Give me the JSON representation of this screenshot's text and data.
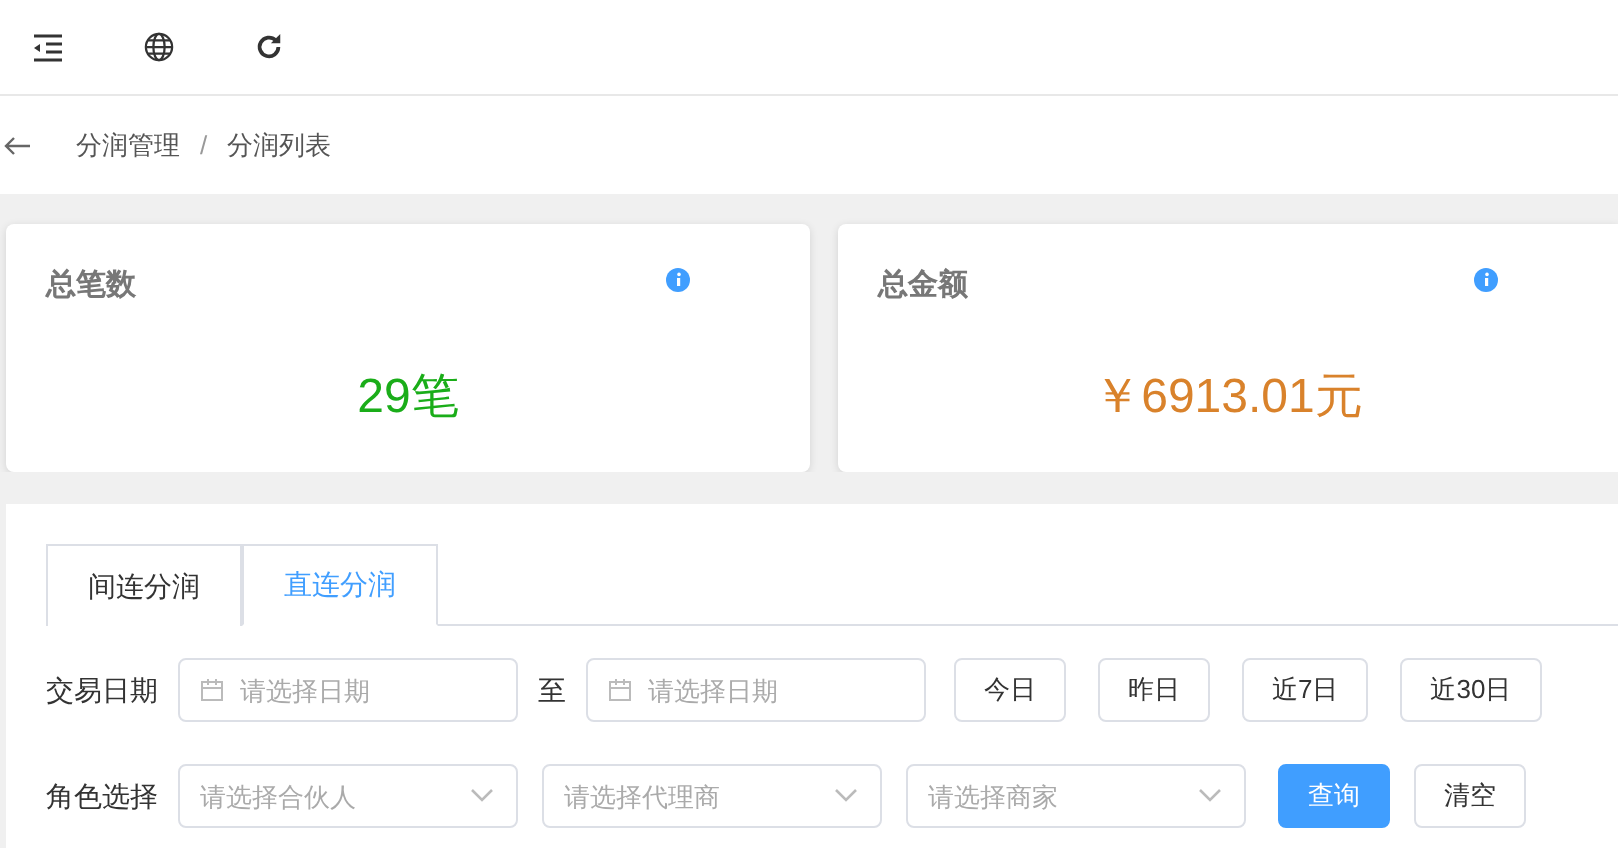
{
  "breadcrumb": [
    "分润管理",
    "分润列表"
  ],
  "breadcrumb_separator": "/",
  "stats": [
    {
      "title": "总笔数",
      "value": "29笔",
      "color": "#1aad19"
    },
    {
      "title": "总金额",
      "value": "￥6913.01元",
      "color": "#d9822b"
    }
  ],
  "tabs": [
    {
      "label": "间连分润",
      "selected": false
    },
    {
      "label": "直连分润",
      "selected": true
    }
  ],
  "date_filter": {
    "label": "交易日期",
    "from": {
      "placeholder": "请选择日期"
    },
    "separator": "至",
    "to": {
      "placeholder": "请选择日期"
    },
    "quick_buttons": [
      "今日",
      "昨日",
      "近7日",
      "近30日"
    ]
  },
  "role_filter": {
    "label": "角色选择",
    "selects": [
      {
        "placeholder": "请选择合伙人"
      },
      {
        "placeholder": "请选择代理商"
      },
      {
        "placeholder": "请选择商家"
      }
    ],
    "buttons": [
      {
        "label": "查询",
        "kind": "primary"
      },
      {
        "label": "清空",
        "kind": "default"
      }
    ]
  }
}
